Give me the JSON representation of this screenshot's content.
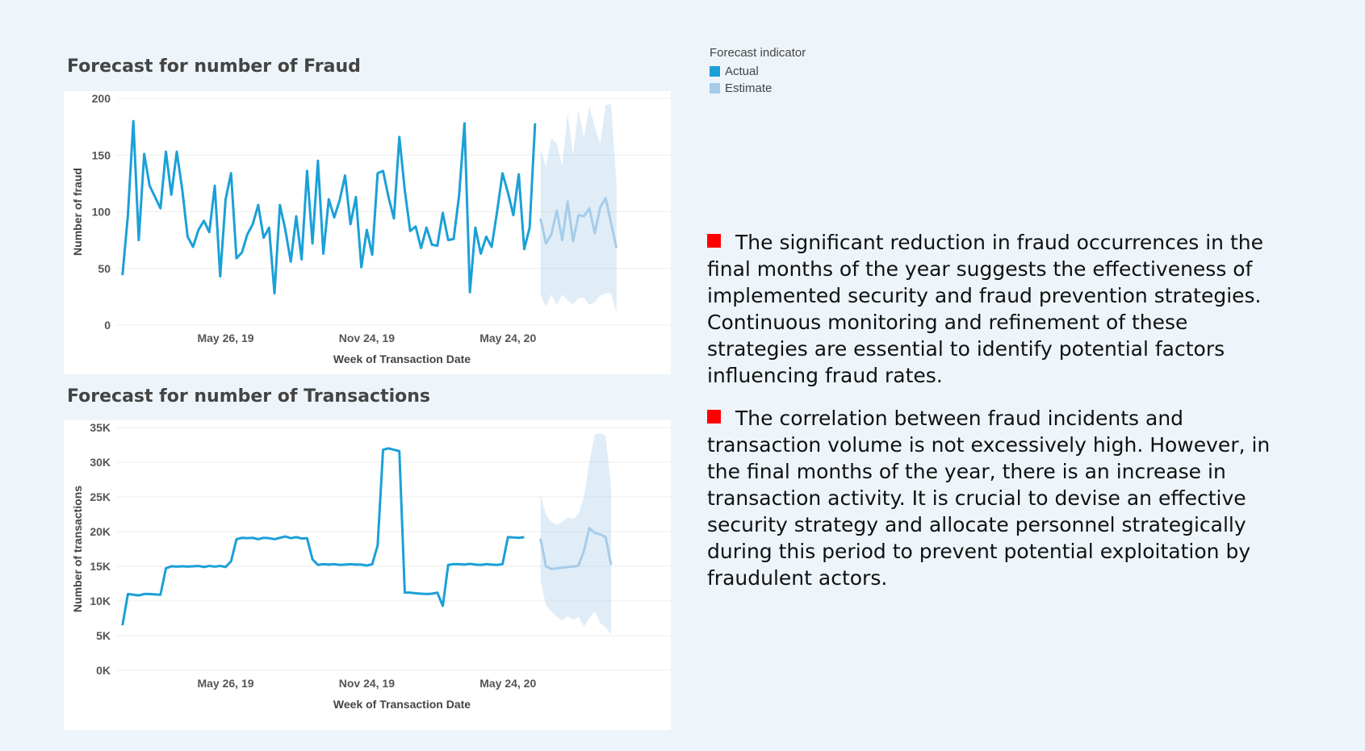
{
  "legend": {
    "title": "Forecast indicator",
    "items": [
      {
        "label": "Actual",
        "color": "#1ba0d8"
      },
      {
        "label": "Estimate",
        "color": "#a6cce9"
      }
    ]
  },
  "commentary": {
    "points": [
      "The significant reduction in fraud occurrences in the final months of the year suggests the effectiveness of implemented security and fraud prevention strategies. Continuous monitoring and refinement of these strategies are essential to identify potential factors influencing fraud rates.",
      "The correlation between fraud incidents and transaction volume is not excessively high. However, in the final months of the year, there is an increase in transaction activity. It is crucial to devise an effective security strategy and allocate personnel strategically during this period to prevent potential exploitation by fraudulent actors."
    ],
    "bullet_color": "#ff0000"
  },
  "chart_data": [
    {
      "type": "line",
      "title": "Forecast for number of Fraud",
      "xlabel": "Week of Transaction Date",
      "ylabel": "Number of fraud",
      "ylim": [
        0,
        200
      ],
      "yticks": [
        0,
        50,
        100,
        150,
        200
      ],
      "ytick_labels": [
        "0",
        "50",
        "100",
        "150",
        "200"
      ],
      "xlim": [
        "2019-01-06",
        "2020-12-20"
      ],
      "xticks": [
        "2019-05-26",
        "2019-11-24",
        "2020-05-24"
      ],
      "xtick_labels": [
        "May 26, 19",
        "Nov 24, 19",
        "May 24, 20"
      ],
      "grid": true,
      "actual": {
        "name": "Actual",
        "start": "2019-01-13",
        "step_days": 7,
        "values": [
          44,
          97,
          180,
          75,
          151,
          123,
          113,
          103,
          153,
          115,
          153,
          120,
          78,
          69,
          84,
          92,
          82,
          123,
          43,
          111,
          134,
          59,
          64,
          80,
          89,
          106,
          77,
          86,
          28,
          106,
          84,
          56,
          96,
          58,
          136,
          72,
          145,
          63,
          111,
          95,
          110,
          132,
          89,
          113,
          51,
          84,
          62,
          134,
          136,
          113,
          94,
          166,
          119,
          83,
          87,
          68,
          86,
          71,
          70,
          99,
          75,
          76,
          114,
          178,
          29,
          86,
          63,
          78,
          69,
          100,
          134,
          117,
          97,
          133,
          67,
          86,
          178
        ]
      },
      "estimate": {
        "name": "Estimate",
        "start": "2020-07-05",
        "step_days": 7,
        "values": [
          94,
          72,
          80,
          101,
          75,
          109,
          74,
          97,
          96,
          103,
          81,
          104,
          112,
          90,
          68
        ],
        "upper": [
          155,
          140,
          165,
          160,
          140,
          187,
          150,
          190,
          165,
          193,
          175,
          160,
          194,
          195,
          125
        ],
        "lower": [
          26,
          16,
          27,
          18,
          27,
          22,
          18,
          24,
          24,
          18,
          20,
          26,
          28,
          28,
          11
        ]
      }
    },
    {
      "type": "line",
      "title": "Forecast for number of Transactions",
      "xlabel": "Week of Transaction Date",
      "ylabel": "Number of transactions",
      "ylim": [
        0,
        35000
      ],
      "yticks": [
        0,
        5000,
        10000,
        15000,
        20000,
        25000,
        30000,
        35000
      ],
      "ytick_labels": [
        "0K",
        "5K",
        "10K",
        "15K",
        "20K",
        "25K",
        "30K",
        "35K"
      ],
      "xlim": [
        "2019-01-06",
        "2020-12-20"
      ],
      "xticks": [
        "2019-05-26",
        "2019-11-24",
        "2020-05-24"
      ],
      "xtick_labels": [
        "May 26, 19",
        "Nov 24, 19",
        "May 24, 20"
      ],
      "grid": true,
      "actual": {
        "name": "Actual",
        "start": "2019-01-13",
        "step_days": 7,
        "values": [
          6500,
          11000,
          10900,
          10800,
          11000,
          11000,
          10950,
          10900,
          14700,
          15000,
          14950,
          15000,
          14950,
          15000,
          15050,
          14900,
          15050,
          14950,
          15050,
          14900,
          15700,
          18900,
          19100,
          19050,
          19100,
          18900,
          19100,
          19050,
          18900,
          19100,
          19300,
          19050,
          19200,
          19000,
          19050,
          16000,
          15200,
          15300,
          15250,
          15300,
          15200,
          15250,
          15300,
          15250,
          15250,
          15100,
          15300,
          18000,
          31800,
          32000,
          31800,
          31600,
          11200,
          11200,
          11100,
          11050,
          11000,
          11050,
          11200,
          9300,
          15200,
          15300,
          15300,
          15250,
          15350,
          15250,
          15200,
          15300,
          15250,
          15200,
          15300,
          19200,
          19150,
          19100,
          19200
        ]
      },
      "estimate": {
        "name": "Estimate",
        "start": "2020-07-05",
        "step_days": 7,
        "values": [
          19000,
          15000,
          14600,
          14700,
          14800,
          14900,
          14950,
          15100,
          17200,
          20500,
          19800,
          19600,
          19200,
          15200
        ],
        "upper": [
          25300,
          22500,
          21400,
          21000,
          21400,
          22000,
          21800,
          22500,
          25000,
          30000,
          34000,
          34200,
          33800,
          26500
        ],
        "lower": [
          13000,
          9300,
          8500,
          7700,
          7200,
          7800,
          7300,
          7700,
          6300,
          7500,
          8500,
          6800,
          6200,
          5200
        ]
      }
    }
  ]
}
